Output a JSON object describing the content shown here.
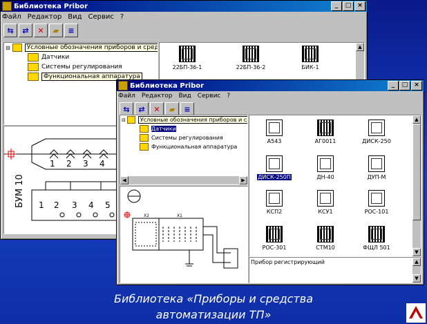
{
  "back_window": {
    "title": "Библиотека Pribor",
    "menu": [
      "Файл",
      "Редактор",
      "Вид",
      "Сервис",
      "?"
    ],
    "tree": {
      "root": "Условные обозначения приборов и средств автоматизации",
      "items": [
        "Датчики",
        "Системы регулирования",
        "Функциональная аппаратура"
      ]
    },
    "library": [
      "22БП-36-1",
      "22БП-36-2",
      "БИК-1"
    ],
    "schematic": {
      "vertical_label": "БУМ 10",
      "top_numbers": [
        "1",
        "2",
        "3",
        "4"
      ],
      "bottom_numbers": [
        "1",
        "2",
        "3",
        "4",
        "5"
      ]
    }
  },
  "front_window": {
    "title": "Библиотека Pribor",
    "menu": [
      "Файл",
      "Редактор",
      "Вид",
      "Сервис",
      "?"
    ],
    "tree": {
      "root": "Условные обозначения приборов и средств автоматизации",
      "items": [
        "Датчики",
        "Системы регулирования",
        "Функциональная аппаратура"
      ]
    },
    "library": [
      "А543",
      "АГ0011",
      "ДИСК-250",
      "ДИСК-250П",
      "ДН-40",
      "ДУП-М",
      "КСП2",
      "КСУ1",
      "РОС-101",
      "РОС-301",
      "СТМ10",
      "ФЩЛ 501"
    ],
    "selected_item": "ДИСК-250П",
    "status": "Прибор регистрирующий",
    "schematic": {
      "labels": [
        "X2",
        "X1"
      ]
    }
  },
  "caption": {
    "line1": "Библиотека «Приборы и средства",
    "line2": "автоматизации ТП»"
  },
  "colors": {
    "titlebar": "#000080",
    "background": "#1740c4",
    "window": "#c0c0c0"
  }
}
